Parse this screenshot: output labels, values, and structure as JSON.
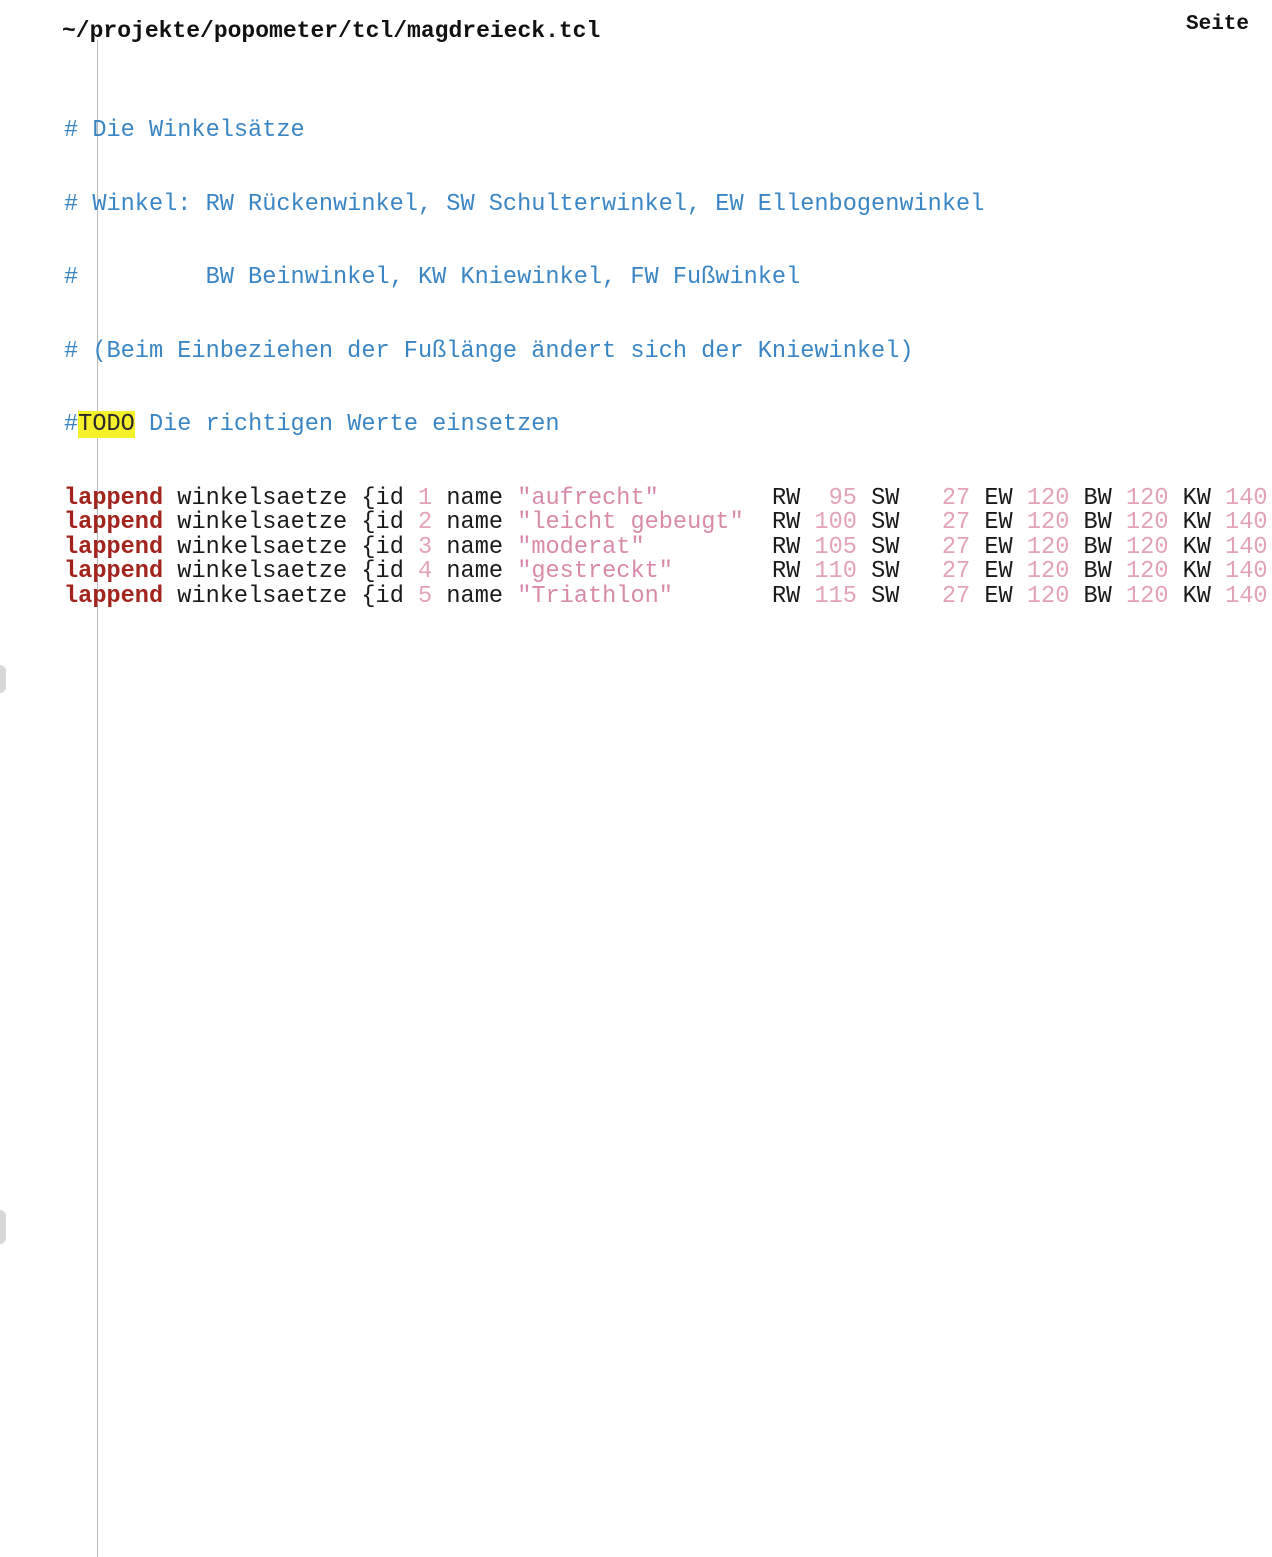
{
  "header": {
    "file_path": "~/projekte/popometer/tcl/magdreieck.tcl",
    "page_label": "Seite"
  },
  "comments": [
    "# Die Winkelsätze",
    "# Winkel: RW Rückenwinkel, SW Schulterwinkel, EW Ellenbogenwinkel",
    "#         BW Beinwinkel, KW Kniewinkel, FW Fußwinkel",
    "# (Beim Einbeziehen der Fußlänge ändert sich der Kniewinkel)"
  ],
  "todo_line": {
    "hash": "#",
    "tag": "TODO",
    "text": " Die richtigen Werte einsetzen"
  },
  "code_rows": [
    {
      "keyword": "lappend",
      "variable": "winkelsaetze",
      "open": "{id",
      "id": "1",
      "name_key": "name",
      "name": "\"aufrecht\"",
      "rw_label": "RW",
      "rw": "95",
      "sw_label": "SW",
      "sw": "27",
      "ew_label": "EW",
      "ew": "120",
      "bw_label": "BW",
      "bw": "120",
      "kw_label": "KW",
      "kw": "140"
    },
    {
      "keyword": "lappend",
      "variable": "winkelsaetze",
      "open": "{id",
      "id": "2",
      "name_key": "name",
      "name": "\"leicht gebeugt\"",
      "rw_label": "RW",
      "rw": "100",
      "sw_label": "SW",
      "sw": "27",
      "ew_label": "EW",
      "ew": "120",
      "bw_label": "BW",
      "bw": "120",
      "kw_label": "KW",
      "kw": "140"
    },
    {
      "keyword": "lappend",
      "variable": "winkelsaetze",
      "open": "{id",
      "id": "3",
      "name_key": "name",
      "name": "\"moderat\"",
      "rw_label": "RW",
      "rw": "105",
      "sw_label": "SW",
      "sw": "27",
      "ew_label": "EW",
      "ew": "120",
      "bw_label": "BW",
      "bw": "120",
      "kw_label": "KW",
      "kw": "140"
    },
    {
      "keyword": "lappend",
      "variable": "winkelsaetze",
      "open": "{id",
      "id": "4",
      "name_key": "name",
      "name": "\"gestreckt\"",
      "rw_label": "RW",
      "rw": "110",
      "sw_label": "SW",
      "sw": "27",
      "ew_label": "EW",
      "ew": "120",
      "bw_label": "BW",
      "bw": "120",
      "kw_label": "KW",
      "kw": "140"
    },
    {
      "keyword": "lappend",
      "variable": "winkelsaetze",
      "open": "{id",
      "id": "5",
      "name_key": "name",
      "name": "\"Triathlon\"",
      "rw_label": "RW",
      "rw": "115",
      "sw_label": "SW",
      "sw": "27",
      "ew_label": "EW",
      "ew": "120",
      "bw_label": "BW",
      "bw": "120",
      "kw_label": "KW",
      "kw": "140"
    }
  ],
  "colors": {
    "comment": "#3a86c4",
    "keyword": "#a2241d",
    "string": "#d88aa8",
    "number": "#e3a2b8",
    "highlight": "#f4f02a"
  }
}
